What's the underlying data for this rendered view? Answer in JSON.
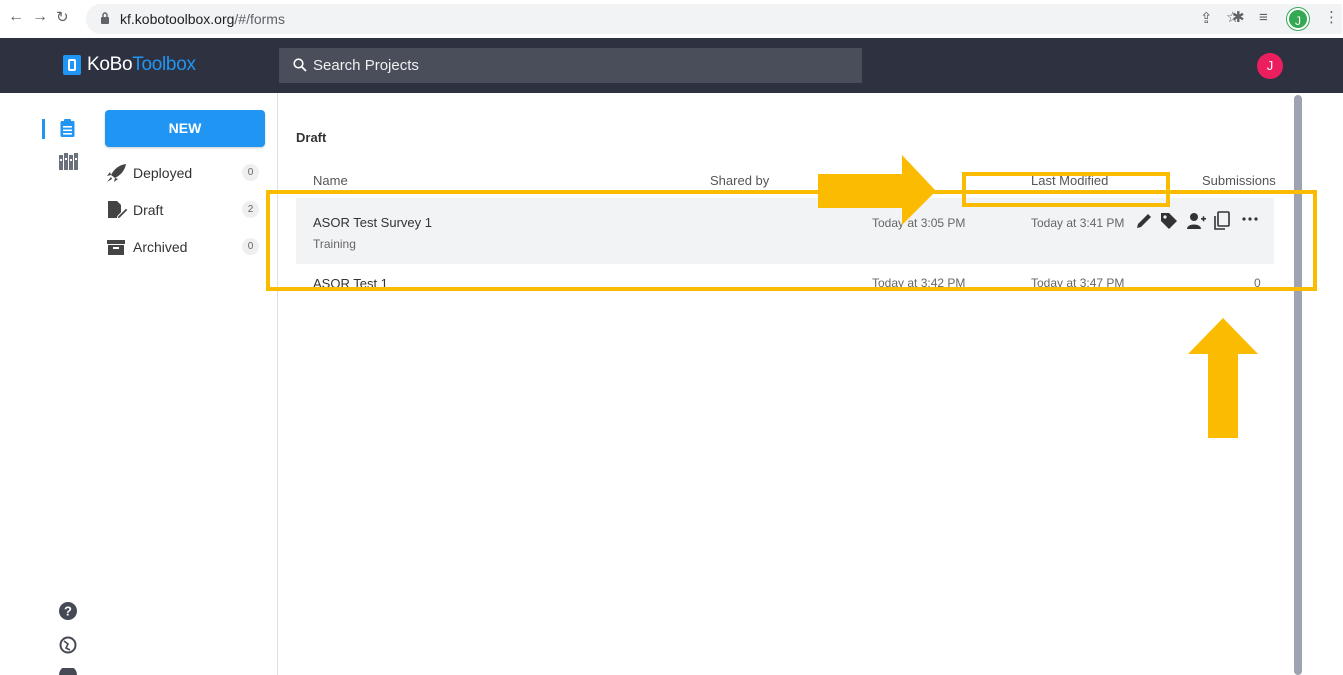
{
  "browser": {
    "url_host": "kf.kobotoolbox.org",
    "url_path": "/#/forms",
    "profile_initial": "J"
  },
  "header": {
    "logo_part1": "KoBo",
    "logo_part2": "Toolbox",
    "search_placeholder": "Search Projects",
    "avatar_initial": "J"
  },
  "sidebar": {
    "new_label": "NEW",
    "items": [
      {
        "label": "Deployed",
        "count": "0"
      },
      {
        "label": "Draft",
        "count": "2"
      },
      {
        "label": "Archived",
        "count": "0"
      }
    ]
  },
  "main": {
    "section_title": "Draft",
    "columns": {
      "name": "Name",
      "shared_by": "Shared by",
      "last_modified": "Last Modified",
      "submissions": "Submissions"
    },
    "rows": [
      {
        "name": "ASOR Test Survey 1",
        "subtitle": "Training",
        "created": "Today at 3:05 PM",
        "modified": "Today at 3:41 PM",
        "submissions": ""
      },
      {
        "name": "ASOR Test 1",
        "subtitle": "",
        "created": "Today at 3:42 PM",
        "modified": "Today at 3:47 PM",
        "submissions": "0"
      }
    ]
  },
  "colors": {
    "header_bg": "#2e3240",
    "accent": "#2095f3",
    "avatar": "#ec1f5e",
    "highlight": "#fbbb00"
  }
}
